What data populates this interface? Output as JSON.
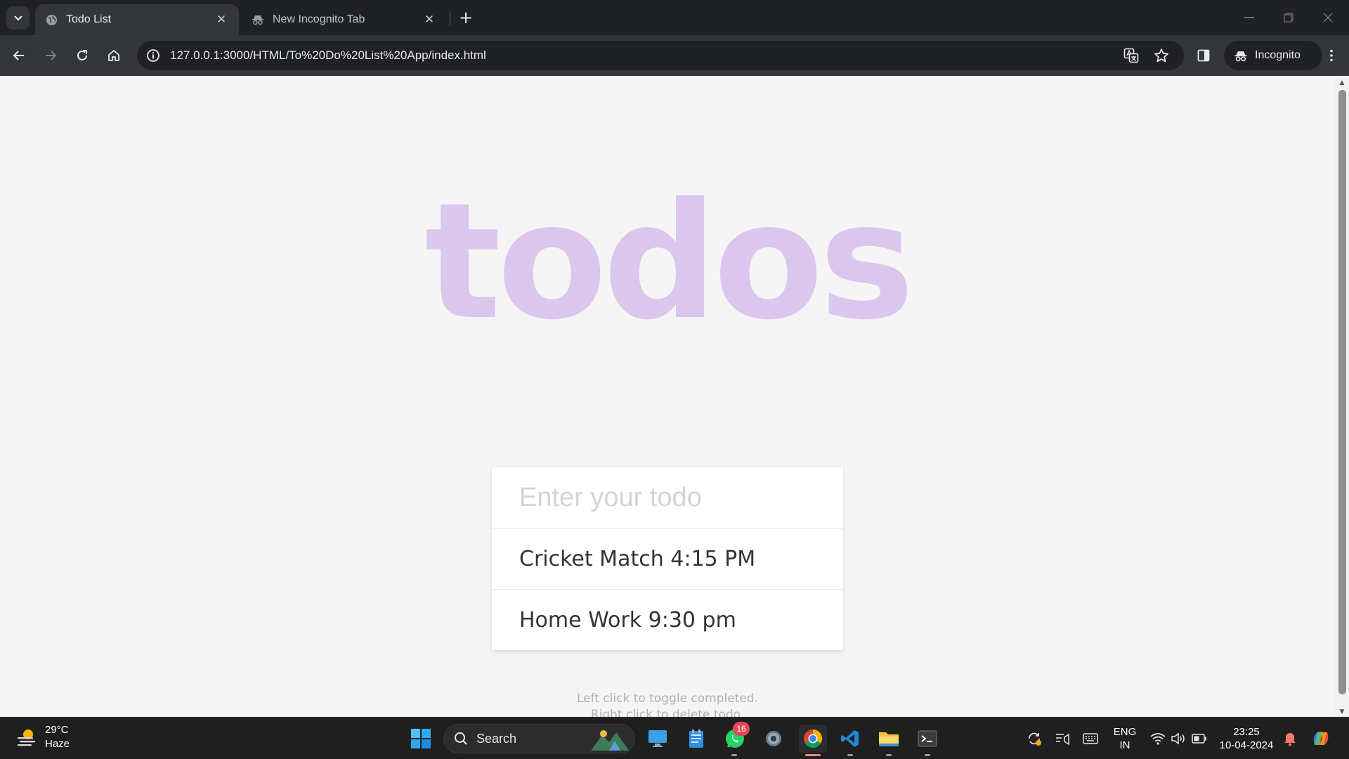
{
  "browser": {
    "tabs": [
      {
        "title": "Todo List",
        "icon": "globe-icon",
        "active": true
      },
      {
        "title": "New Incognito Tab",
        "icon": "incognito-icon",
        "active": false
      }
    ],
    "url": "127.0.0.1:3000/HTML/To%20Do%20List%20App/index.html",
    "profile_label": "Incognito"
  },
  "app": {
    "title": "todos",
    "input_placeholder": "Enter your todo",
    "todos": [
      {
        "text": "Cricket Match 4:15 PM"
      },
      {
        "text": "Home Work 9:30 pm"
      }
    ],
    "hints": [
      "Left click to toggle completed.",
      "Right click to delete todo."
    ],
    "colors": {
      "title": "#dbc6ee",
      "background": "#f5f5f5"
    }
  },
  "taskbar": {
    "weather": {
      "temp": "29°C",
      "condition": "Haze"
    },
    "search_label": "Search",
    "whatsapp_badge": "16",
    "language": {
      "line1": "ENG",
      "line2": "IN"
    },
    "clock": {
      "time": "23:25",
      "date": "10-04-2024"
    }
  }
}
